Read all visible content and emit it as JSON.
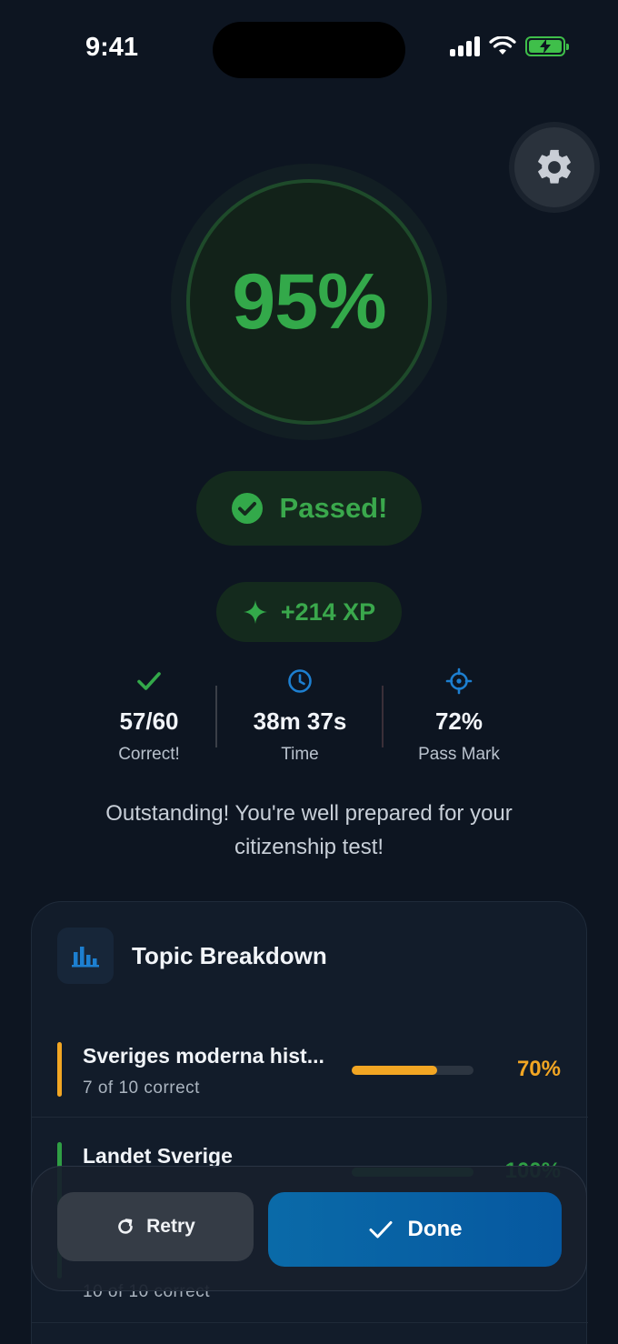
{
  "status_bar": {
    "time": "9:41"
  },
  "colors": {
    "pass_green": "#33a94a",
    "warning_orange": "#f2a623",
    "accent_blue": "#1d7fd0",
    "done_blue": "#0a6aa8"
  },
  "score": {
    "percent_label": "95%",
    "percent": 95
  },
  "result": {
    "label": "Passed!",
    "icon": "check-circle-icon"
  },
  "xp": {
    "label": "+214 XP",
    "icon": "sparkle-icon"
  },
  "stats": [
    {
      "value": "57/60",
      "label": "Correct!",
      "icon": "check-icon"
    },
    {
      "value": "38m 37s",
      "label": "Time",
      "icon": "clock-icon"
    },
    {
      "value": "72%",
      "label": "Pass Mark",
      "icon": "target-icon"
    }
  ],
  "message": "Outstanding! You're well prepared for your citizenship test!",
  "topic_breakdown": {
    "title": "Topic Breakdown",
    "icon": "bar-chart-icon",
    "topics": [
      {
        "name": "Sveriges moderna hist...",
        "detail": "7 of 10 correct",
        "percent_label": "70%",
        "progress": 0.7,
        "color": "#f2a623"
      },
      {
        "name": "Landet Sverige",
        "detail": "10 of 10 correct",
        "percent_label": "100%",
        "progress": 1.0,
        "color": "#2f9e44"
      }
    ]
  },
  "actions": {
    "retry_label": "Retry",
    "done_label": "Done"
  }
}
